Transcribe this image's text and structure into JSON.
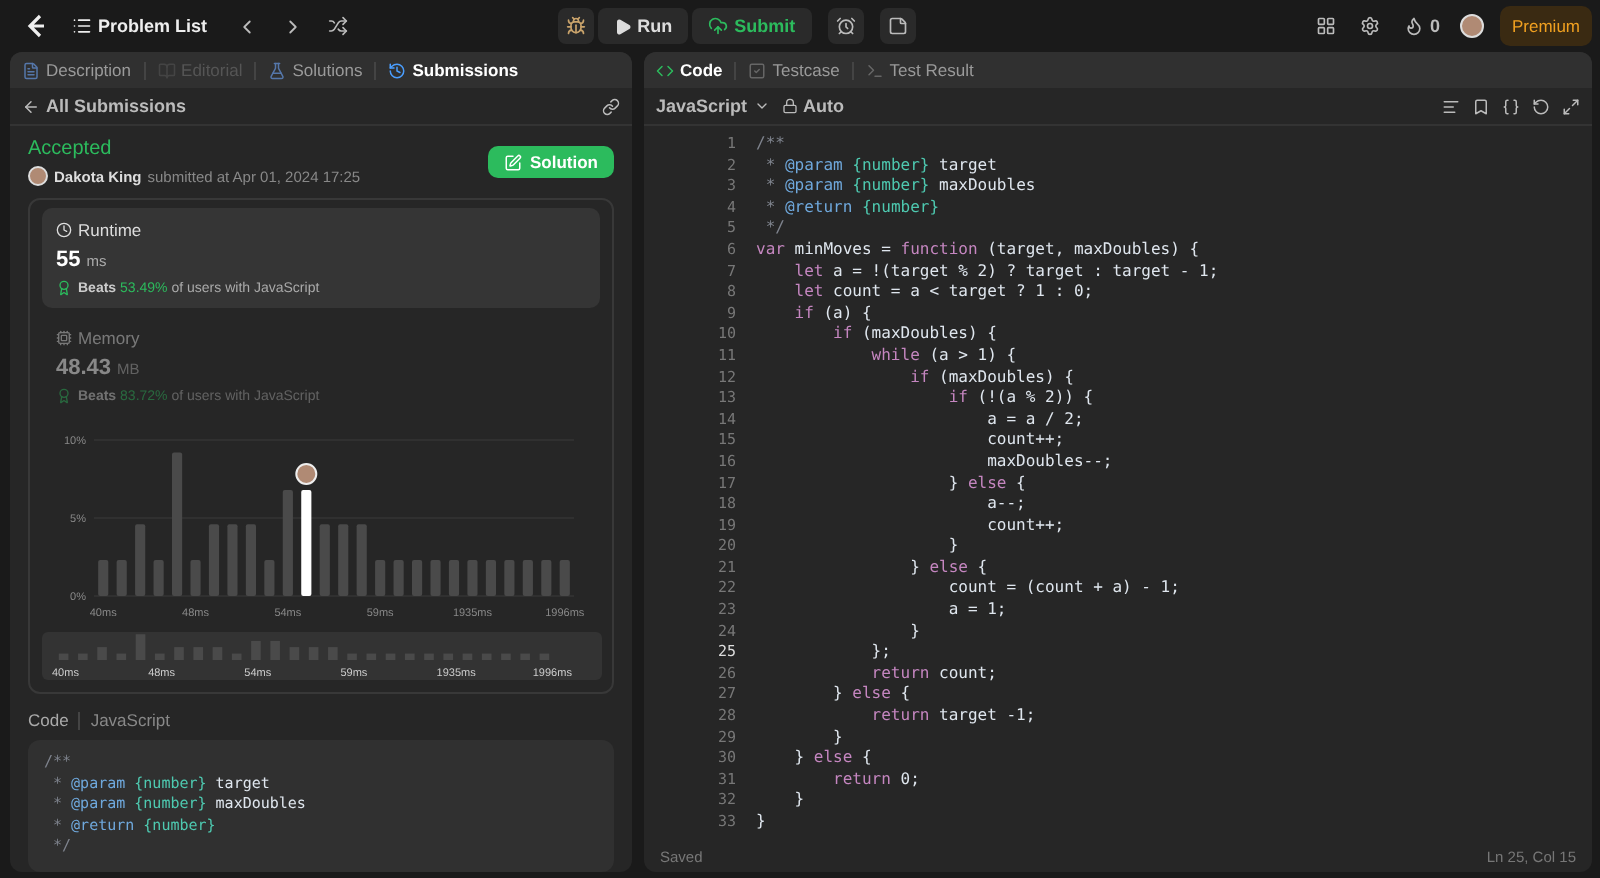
{
  "topbar": {
    "problem_list": "Problem List",
    "run": "Run",
    "submit": "Submit",
    "streak": "0",
    "premium": "Premium"
  },
  "left_tabs": [
    {
      "label": "Description",
      "kind": "doc",
      "selected": false,
      "disabled": false
    },
    {
      "label": "Editorial",
      "kind": "book",
      "selected": false,
      "disabled": true
    },
    {
      "label": "Solutions",
      "kind": "flask",
      "selected": false,
      "disabled": false
    },
    {
      "label": "Submissions",
      "kind": "history",
      "selected": true,
      "disabled": false
    }
  ],
  "back_link": "All Submissions",
  "submission": {
    "status": "Accepted",
    "author": "Dakota King",
    "submitted": "submitted at Apr 01, 2024 17:25",
    "solution_button": "Solution"
  },
  "stats": [
    {
      "kind": "time",
      "label": "Runtime",
      "value": "55",
      "unit": "ms",
      "beats": "Beats",
      "percent": "53.49%",
      "suffix": "of users with JavaScript",
      "selected": true
    },
    {
      "kind": "memory",
      "label": "Memory",
      "value": "48.43",
      "unit": "MB",
      "beats": "Beats",
      "percent": "83.72%",
      "suffix": "of users with JavaScript",
      "selected": false
    }
  ],
  "chart_data": {
    "type": "bar",
    "categories": [
      "40ms",
      null,
      null,
      null,
      null,
      "48ms",
      null,
      null,
      null,
      null,
      "54ms",
      null,
      null,
      null,
      null,
      "59ms",
      null,
      null,
      null,
      null,
      "1935ms",
      null,
      null,
      null,
      null,
      "1996ms"
    ],
    "stacked": true,
    "series": [
      {
        "color": "#4a4a4a",
        "values": [
          2.3,
          2.3,
          4.6,
          2.3,
          9.2,
          2.3,
          4.6,
          4.6,
          4.6,
          2.3,
          6.8,
          null,
          4.6,
          4.6,
          4.6,
          2.3,
          2.3,
          2.3,
          2.3,
          2.3,
          2.3,
          2.3,
          2.3,
          2.3,
          2.3,
          2.3
        ]
      },
      {
        "color": "#ffffff",
        "values": [
          null,
          null,
          null,
          null,
          null,
          null,
          null,
          null,
          null,
          null,
          null,
          6.8,
          null,
          null,
          null,
          null,
          null,
          null,
          null,
          null,
          null,
          null,
          null,
          null,
          null,
          null
        ]
      }
    ],
    "ylim": [
      0,
      10
    ],
    "yticks": [
      {
        "value": 0,
        "label": "0%"
      },
      {
        "value": 5,
        "label": "5%"
      },
      {
        "value": 10,
        "label": "10%"
      }
    ]
  },
  "overview_labels": [
    "40ms",
    "48ms",
    "54ms",
    "59ms",
    "1935ms",
    "1996ms"
  ],
  "code_header": {
    "title": "Code",
    "language": "JavaScript"
  },
  "submitted_code": [
    [
      {
        "kind": "c",
        "text": "/**"
      }
    ],
    [
      {
        "kind": "c",
        "text": " * "
      },
      {
        "kind": "tag",
        "text": "@param"
      },
      {
        "kind": "ty",
        "text": " {number}"
      },
      {
        "kind": "p",
        "text": " target"
      }
    ],
    [
      {
        "kind": "c",
        "text": " * "
      },
      {
        "kind": "tag",
        "text": "@param"
      },
      {
        "kind": "ty",
        "text": " {number}"
      },
      {
        "kind": "p",
        "text": " maxDoubles"
      }
    ],
    [
      {
        "kind": "c",
        "text": " * "
      },
      {
        "kind": "tag",
        "text": "@return"
      },
      {
        "kind": "ty",
        "text": " {number}"
      }
    ],
    [
      {
        "kind": "c",
        "text": " */"
      }
    ]
  ],
  "editor": {
    "tabs": [
      {
        "label": "Code",
        "kind": "code",
        "selected": true
      },
      {
        "label": "Testcase",
        "kind": "check",
        "selected": false
      },
      {
        "label": "Test Result",
        "kind": "terminal",
        "selected": false
      }
    ],
    "language": "JavaScript",
    "mode": "Auto",
    "status": "Saved",
    "cursor": "Ln 25, Col 15",
    "lines": [
      {
        "n": "1",
        "current": false,
        "tokens": [
          {
            "kind": "c",
            "text": "/**"
          }
        ]
      },
      {
        "n": "2",
        "current": false,
        "tokens": [
          {
            "kind": "c",
            "text": " * "
          },
          {
            "kind": "tag",
            "text": "@param"
          },
          {
            "kind": "ty",
            "text": " {number}"
          },
          {
            "kind": "p",
            "text": " target"
          }
        ]
      },
      {
        "n": "3",
        "current": false,
        "tokens": [
          {
            "kind": "c",
            "text": " * "
          },
          {
            "kind": "tag",
            "text": "@param"
          },
          {
            "kind": "ty",
            "text": " {number}"
          },
          {
            "kind": "p",
            "text": " maxDoubles"
          }
        ]
      },
      {
        "n": "4",
        "current": false,
        "tokens": [
          {
            "kind": "c",
            "text": " * "
          },
          {
            "kind": "tag",
            "text": "@return"
          },
          {
            "kind": "ty",
            "text": " {number}"
          }
        ]
      },
      {
        "n": "5",
        "current": false,
        "tokens": [
          {
            "kind": "c",
            "text": " */"
          }
        ]
      },
      {
        "n": "6",
        "current": false,
        "tokens": [
          {
            "kind": "kw",
            "text": "var"
          },
          {
            "kind": "p",
            "text": " minMoves = "
          },
          {
            "kind": "kw",
            "text": "function"
          },
          {
            "kind": "p",
            "text": " (target, maxDoubles) {"
          }
        ]
      },
      {
        "n": "7",
        "current": false,
        "tokens": [
          {
            "kind": "kw",
            "text": "    let"
          },
          {
            "kind": "p",
            "text": " a = !(target % 2) ? target : target - 1;"
          }
        ]
      },
      {
        "n": "8",
        "current": false,
        "tokens": [
          {
            "kind": "kw",
            "text": "    let"
          },
          {
            "kind": "p",
            "text": " count = a < target ? 1 : 0;"
          }
        ]
      },
      {
        "n": "9",
        "current": false,
        "tokens": [
          {
            "kind": "kw",
            "text": "    if"
          },
          {
            "kind": "p",
            "text": " (a) {"
          }
        ]
      },
      {
        "n": "10",
        "current": false,
        "tokens": [
          {
            "kind": "kw",
            "text": "        if"
          },
          {
            "kind": "p",
            "text": " (maxDoubles) {"
          }
        ]
      },
      {
        "n": "11",
        "current": false,
        "tokens": [
          {
            "kind": "kw",
            "text": "            while"
          },
          {
            "kind": "p",
            "text": " (a > 1) {"
          }
        ]
      },
      {
        "n": "12",
        "current": false,
        "tokens": [
          {
            "kind": "kw",
            "text": "                if"
          },
          {
            "kind": "p",
            "text": " (maxDoubles) {"
          }
        ]
      },
      {
        "n": "13",
        "current": false,
        "tokens": [
          {
            "kind": "kw",
            "text": "                    if"
          },
          {
            "kind": "p",
            "text": " (!(a % 2)) {"
          }
        ]
      },
      {
        "n": "14",
        "current": false,
        "tokens": [
          {
            "kind": "p",
            "text": "                        a = a / 2;"
          }
        ]
      },
      {
        "n": "15",
        "current": false,
        "tokens": [
          {
            "kind": "p",
            "text": "                        count++;"
          }
        ]
      },
      {
        "n": "16",
        "current": false,
        "tokens": [
          {
            "kind": "p",
            "text": "                        maxDoubles--;"
          }
        ]
      },
      {
        "n": "17",
        "current": false,
        "tokens": [
          {
            "kind": "p",
            "text": "                    } "
          },
          {
            "kind": "kw",
            "text": "else"
          },
          {
            "kind": "p",
            "text": " {"
          }
        ]
      },
      {
        "n": "18",
        "current": false,
        "tokens": [
          {
            "kind": "p",
            "text": "                        a--;"
          }
        ]
      },
      {
        "n": "19",
        "current": false,
        "tokens": [
          {
            "kind": "p",
            "text": "                        count++;"
          }
        ]
      },
      {
        "n": "20",
        "current": false,
        "tokens": [
          {
            "kind": "p",
            "text": "                    }"
          }
        ]
      },
      {
        "n": "21",
        "current": false,
        "tokens": [
          {
            "kind": "p",
            "text": "                } "
          },
          {
            "kind": "kw",
            "text": "else"
          },
          {
            "kind": "p",
            "text": " {"
          }
        ]
      },
      {
        "n": "22",
        "current": false,
        "tokens": [
          {
            "kind": "p",
            "text": "                    count = (count + a) - 1;"
          }
        ]
      },
      {
        "n": "23",
        "current": false,
        "tokens": [
          {
            "kind": "p",
            "text": "                    a = 1;"
          }
        ]
      },
      {
        "n": "24",
        "current": false,
        "tokens": [
          {
            "kind": "p",
            "text": "                }"
          }
        ]
      },
      {
        "n": "25",
        "current": true,
        "tokens": [
          {
            "kind": "p",
            "text": "            };"
          }
        ]
      },
      {
        "n": "26",
        "current": false,
        "tokens": [
          {
            "kind": "kw",
            "text": "            return"
          },
          {
            "kind": "p",
            "text": " count;"
          }
        ]
      },
      {
        "n": "27",
        "current": false,
        "tokens": [
          {
            "kind": "p",
            "text": "        } "
          },
          {
            "kind": "kw",
            "text": "else"
          },
          {
            "kind": "p",
            "text": " {"
          }
        ]
      },
      {
        "n": "28",
        "current": false,
        "tokens": [
          {
            "kind": "kw",
            "text": "            return"
          },
          {
            "kind": "p",
            "text": " target -1;"
          }
        ]
      },
      {
        "n": "29",
        "current": false,
        "tokens": [
          {
            "kind": "p",
            "text": "        }"
          }
        ]
      },
      {
        "n": "30",
        "current": false,
        "tokens": [
          {
            "kind": "p",
            "text": "    } "
          },
          {
            "kind": "kw",
            "text": "else"
          },
          {
            "kind": "p",
            "text": " {"
          }
        ]
      },
      {
        "n": "31",
        "current": false,
        "tokens": [
          {
            "kind": "kw",
            "text": "        return"
          },
          {
            "kind": "p",
            "text": " 0;"
          }
        ]
      },
      {
        "n": "32",
        "current": false,
        "tokens": [
          {
            "kind": "p",
            "text": "    }"
          }
        ]
      },
      {
        "n": "33",
        "current": false,
        "tokens": [
          {
            "kind": "p",
            "text": "}"
          }
        ]
      }
    ]
  }
}
